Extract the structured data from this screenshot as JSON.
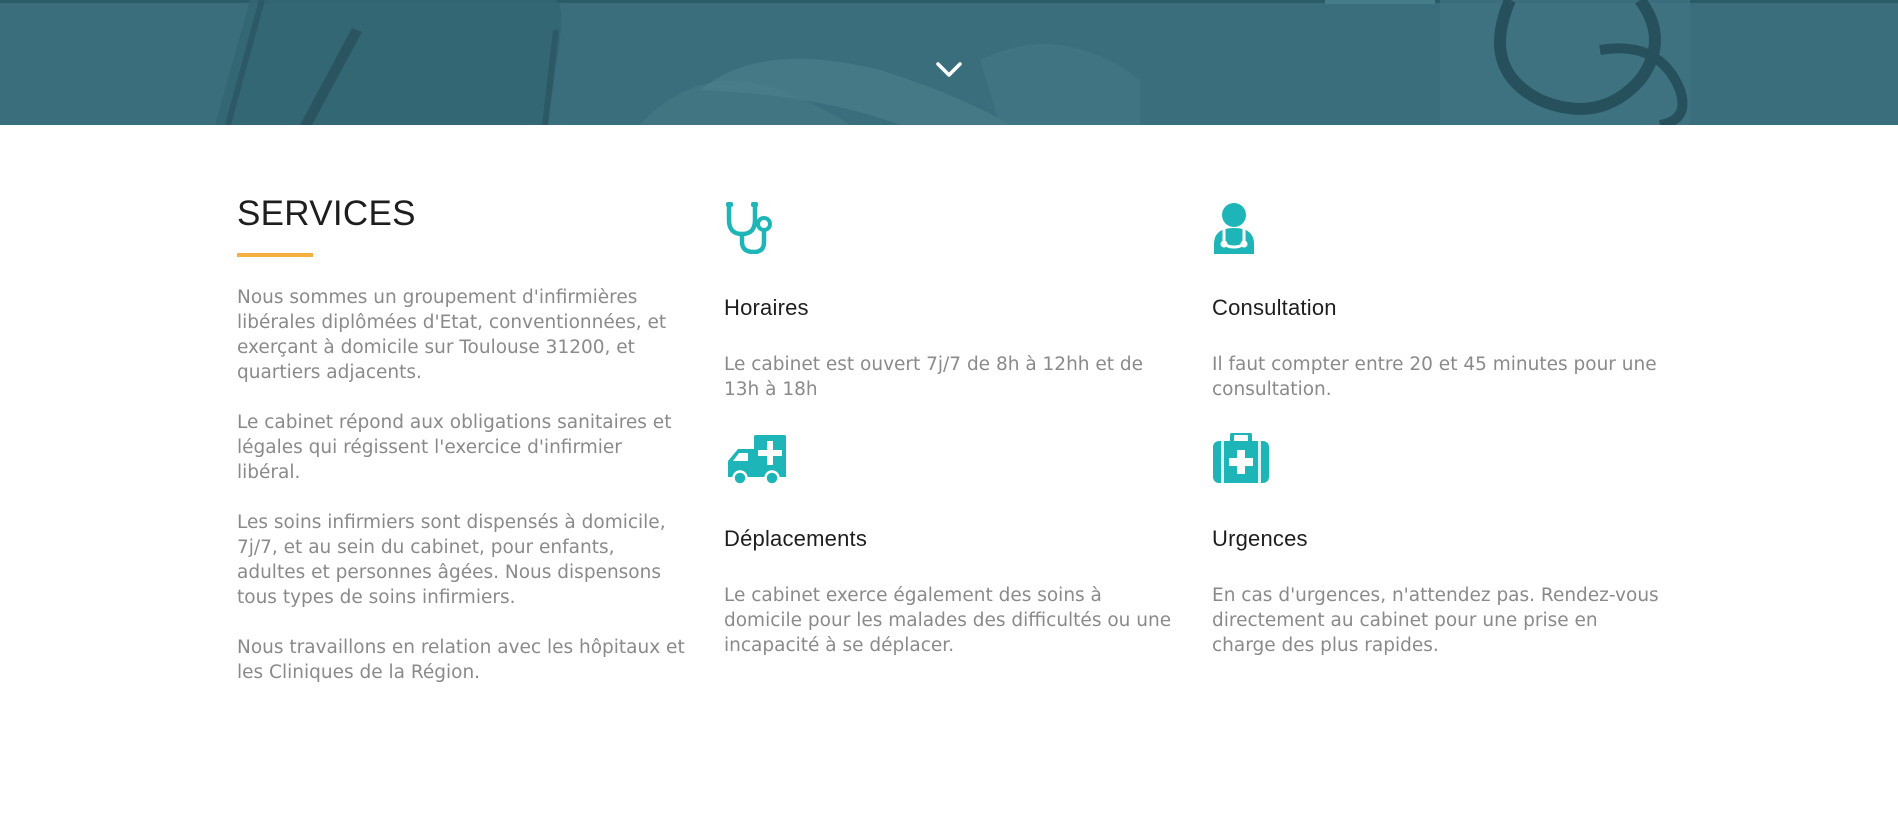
{
  "colors": {
    "accent_teal": "#1db5b8",
    "underline_orange": "#f5b041",
    "hero_overlay": "#3d6f7d",
    "body_text": "#8a8a8a",
    "heading_text": "#1e1e1e"
  },
  "hero": {
    "scroll_icon": "chevron-down-icon"
  },
  "services": {
    "title": "SERVICES",
    "paragraphs": [
      "Nous sommes un groupement d'infirmières libérales diplômées d'Etat, conventionnées, et exerçant à domicile sur Toulouse 31200, et quartiers adjacents.",
      "Le cabinet répond aux obligations sanitaires et légales qui régissent l'exercice d'infirmier libéral.",
      "Les soins infirmiers sont dispensés à domicile, 7j/7, et au sein du cabinet, pour enfants, adultes et personnes âgées. Nous dispensons tous types de soins infirmiers.",
      "Nous travaillons en relation avec les hôpitaux et les Cliniques de la Région."
    ],
    "features": [
      {
        "icon": "stethoscope-icon",
        "title": "Horaires",
        "text": "Le cabinet est ouvert 7j/7 de 8h à 12hh et de 13h à 18h"
      },
      {
        "icon": "doctor-icon",
        "title": "Consultation",
        "text": "Il faut compter entre 20 et 45 minutes pour une consultation."
      },
      {
        "icon": "ambulance-icon",
        "title": "Déplacements",
        "text": "Le cabinet exerce également des soins à domicile pour les malades des difficultés ou une incapacité à se déplacer."
      },
      {
        "icon": "medical-kit-icon",
        "title": "Urgences",
        "text": "En cas d'urgences, n'attendez pas. Rendez-vous directement au cabinet pour une prise en charge des plus rapides."
      }
    ]
  }
}
